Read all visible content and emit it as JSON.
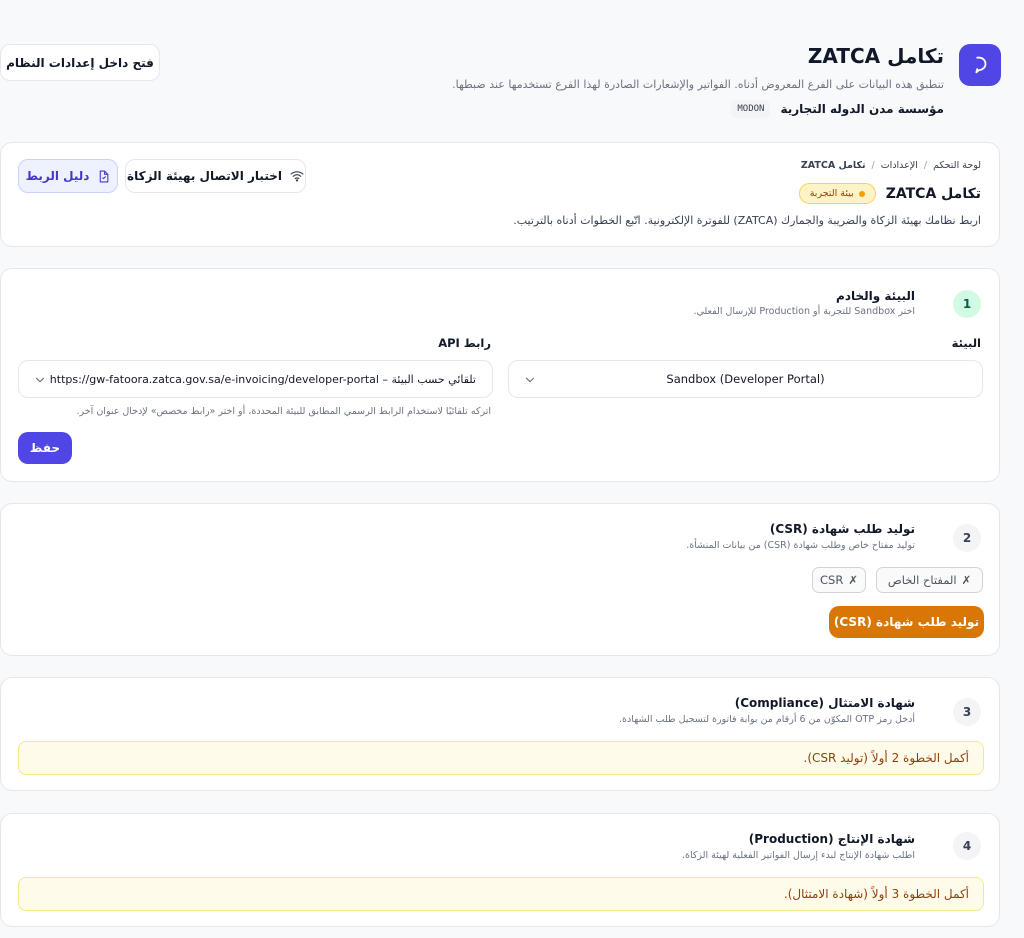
{
  "header": {
    "title": "تكامل ZATCA",
    "subtitle": "تنطبق هذه البيانات على الفرع المعروض أدناه. الفواتير والإشعارات الصادرة لهذا الفرع تستخدمها عند ضبطها.",
    "org_name": "مؤسسة مدن الدوله التجارية",
    "org_code": "MODON",
    "open_settings_label": "فتح داخل إعدادات النظام"
  },
  "page_card": {
    "breadcrumb": [
      "لوحة التحكم",
      "الإعدادات",
      "تكامل ZATCA"
    ],
    "breadcrumb_sep": "/",
    "title": "تكامل ZATCA",
    "env_badge": "بيئة التجربة",
    "description": "اربط نظامك بهيئة الزكاة والضريبة والجمارك (ZATCA) للفوترة الإلكترونية. اتّبع الخطوات أدناه بالترتيب.",
    "test_connection_label": "اختبار الاتصال بهيئة الزكاة",
    "guide_label": "دليل الربط"
  },
  "step1": {
    "number": "1",
    "title": "البيئة والخادم",
    "desc": "اختر Sandbox للتجربة أو Production للإرسال الفعلي.",
    "env_label": "البيئة",
    "env_value": "Sandbox (Developer Portal)",
    "api_label": "رابط API",
    "api_value": "تلقائي حسب البيئة – https://gw-fatoora.zatca.gov.sa/e-invoicing/developer-portal",
    "api_help": "اتركه تلقائيًا لاستخدام الرابط الرسمي المطابق للبيئة المحددة، أو اختر «رابط مخصص» لإدخال عنوان آخر.",
    "save_label": "حفظ"
  },
  "step2": {
    "number": "2",
    "title": "توليد طلب شهادة (CSR)",
    "desc": "توليد مفتاح خاص وطلب شهادة (CSR) من بيانات المنشأة.",
    "chip_private_key": "المفتاح الخاص",
    "chip_csr": "CSR",
    "chip_mark": "✗",
    "generate_label": "توليد طلب شهادة (CSR)"
  },
  "step3": {
    "number": "3",
    "title": "شهادة الامتثال (Compliance)",
    "desc": "أدخل رمز OTP المكوّن من 6 أرقام من بوابة فاتورة لتسجيل طلب الشهادة.",
    "warning": "أكمل الخطوة 2 أولاً (توليد CSR)."
  },
  "step4": {
    "number": "4",
    "title": "شهادة الإنتاج (Production)",
    "desc": "اطلب شهادة الإنتاج لبدء إرسال الفواتير الفعلية لهيئة الزكاة.",
    "warning": "أكمل الخطوة 3 أولاً (شهادة الامتثال)."
  },
  "colors": {
    "primary": "#4f46e5",
    "orange": "#d97706",
    "badge_bg": "#fef3c7",
    "step1_bg": "#d1fae5"
  },
  "icons": {
    "logo": "chat-bubble-icon",
    "wifi": "wifi-icon",
    "guide": "document-icon",
    "chevron": "chevron-down-icon"
  }
}
